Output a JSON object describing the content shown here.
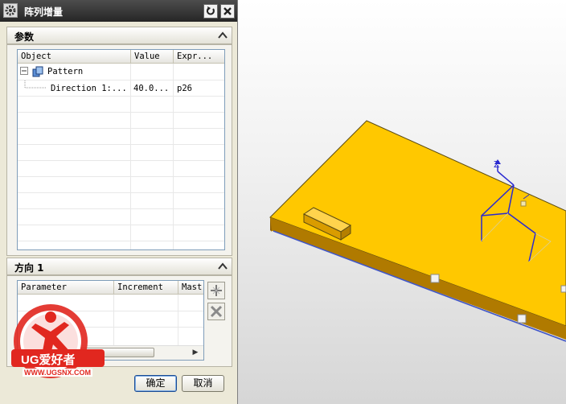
{
  "dialog": {
    "title": "阵列增量",
    "params_section": {
      "title": "参数"
    },
    "params_table": {
      "columns": [
        "Object",
        "Value",
        "Expr..."
      ],
      "rows": [
        {
          "object": "Pattern",
          "value": "",
          "expr": ""
        },
        {
          "object": "Direction 1:...",
          "value": "40.0...",
          "expr": "p26"
        }
      ]
    },
    "direction_section": {
      "title": "方向 1"
    },
    "direction_table": {
      "columns": [
        "Parameter",
        "Increment",
        "Mast"
      ]
    },
    "watermark": {
      "text": "UG爱好者",
      "url": "WWW.UGSNX.COM"
    },
    "buttons": {
      "ok": "确定",
      "cancel": "取消"
    }
  },
  "viewport": {
    "axis_label": "Z",
    "part_color": "#ffc800"
  }
}
